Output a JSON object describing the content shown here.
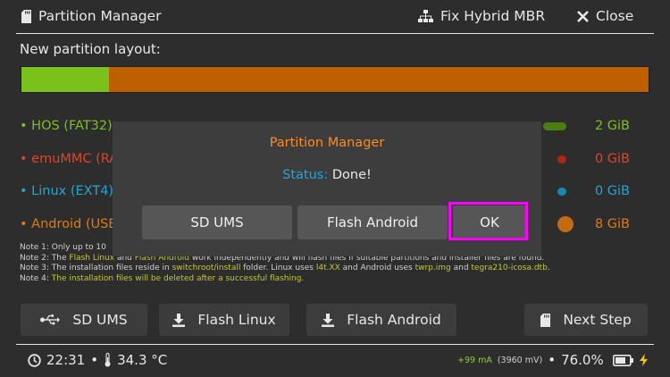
{
  "header": {
    "title": "Partition Manager",
    "fix_hybrid_label": "Fix Hybrid MBR",
    "close_label": "Close"
  },
  "layout_label": "New partition layout:",
  "partition_bar": {
    "hos_color": "#7ac21b",
    "android_color": "#bf6000"
  },
  "partitions": [
    {
      "label": "• HOS (FAT32)",
      "size": "2 GiB",
      "color": "#7ac21b"
    },
    {
      "label": "• emuMMC (RAW)",
      "size": "0 GiB",
      "color": "#e0442a"
    },
    {
      "label": "• Linux (EXT4)",
      "size": "0 GiB",
      "color": "#21a6d8"
    },
    {
      "label": "• Android (USER)",
      "size": "8 GiB",
      "color": "#e07a10"
    }
  ],
  "notes": [
    {
      "pre": "Note 1: Only up to 10",
      "y1": "",
      "mid": "",
      "y2": "",
      "post": ""
    },
    {
      "pre": "Note 2: The ",
      "y1": "Flash Linux",
      "mid": " and ",
      "y2": "Flash Android",
      "post": " work independently and will flash files if suitable partitions and installer files are found."
    },
    {
      "pre": "Note 3: The installation files reside in ",
      "y1": "switchroot/install",
      "mid": " folder. Linux uses ",
      "y2": "l4t.XX",
      "post": " and Android uses "
    },
    {
      "pre": "Note 4: ",
      "y1": "The installation files will be deleted after a successful flashing.",
      "mid": "",
      "y2": "",
      "post": ""
    }
  ],
  "note3_tail": {
    "twrp": "twrp.img",
    "and": " and ",
    "tegra": "tegra210-icosa.dtb",
    "end": "."
  },
  "actions": {
    "sd_ums": "SD UMS",
    "flash_linux": "Flash Linux",
    "flash_android": "Flash Android",
    "next_step": "Next Step"
  },
  "footer": {
    "time": "22:31",
    "temp": "34.3 °C",
    "current": "+99 mA",
    "voltage": "(3960 mV)",
    "battery": "76.0%"
  },
  "dialog": {
    "title": "Partition Manager",
    "status_key": "Status:",
    "status_value": "Done!",
    "sd_ums": "SD UMS",
    "flash_android": "Flash Android",
    "ok": "OK"
  }
}
